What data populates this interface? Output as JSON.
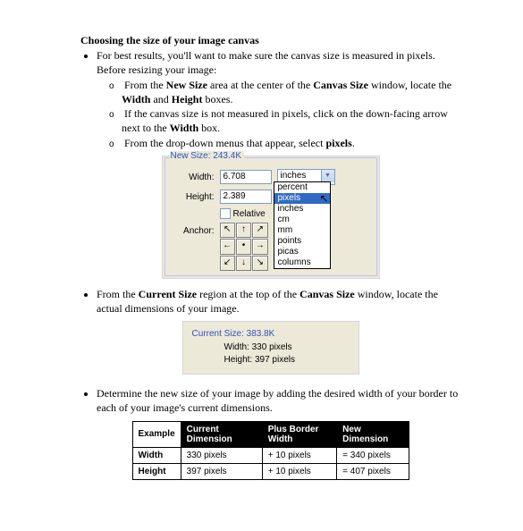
{
  "heading": "Choosing the size of your image canvas",
  "intro": "For best results, you'll want to make sure the canvas size is measured in pixels.  Before resizing your image:",
  "sub": [
    {
      "pre": "From the ",
      "b1": "New Size",
      "mid1": " area at the center of the ",
      "b2": "Canvas Size",
      "mid2": " window, locate the ",
      "b3": "Width",
      "mid3": " and ",
      "b4": "Height",
      "end": " boxes."
    },
    {
      "pre": "If the canvas size is not measured in pixels, click on the down-facing arrow next to the ",
      "b1": "Width",
      "end": " box."
    },
    {
      "pre": "From the drop-down menus that appear, select ",
      "b1": "pixels",
      "end": "."
    }
  ],
  "panel1": {
    "legend": "New Size: 243.4K",
    "width_label": "Width:",
    "width_value": "6.708",
    "height_label": "Height:",
    "height_value": "2.389",
    "unit": "inches",
    "relative_label": "Relative",
    "anchor_label": "Anchor:",
    "dropdown": [
      "percent",
      "pixels",
      "inches",
      "cm",
      "mm",
      "points",
      "picas",
      "columns"
    ]
  },
  "bullet2": {
    "pre": "From the ",
    "b1": "Current Size",
    "mid": " region at the top of the ",
    "b2": "Canvas Size",
    "end": " window, locate the actual dimensions of your image."
  },
  "panel2": {
    "legend": "Current Size: 383.8K",
    "width": "Width:  330 pixels",
    "height": "Height:  397 pixels"
  },
  "bullet3": "Determine the new size of your image by adding the desired width of your border to each of your image's current dimensions.",
  "table": {
    "headers": [
      "Example",
      "Current Dimension",
      "Plus Border Width",
      "New Dimension"
    ],
    "rows": [
      [
        "Width",
        "330 pixels",
        "+ 10 pixels",
        "= 340 pixels"
      ],
      [
        "Height",
        "397 pixels",
        "+ 10 pixels",
        "= 407 pixels"
      ]
    ]
  }
}
